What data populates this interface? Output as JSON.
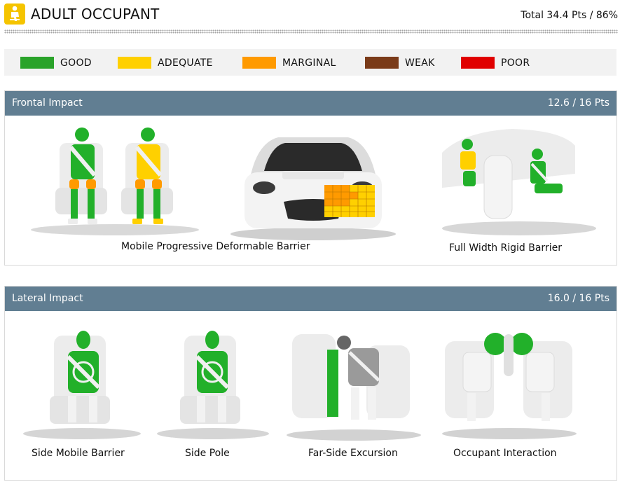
{
  "header": {
    "title": "ADULT OCCUPANT",
    "total": "Total 34.4 Pts / 86%",
    "icon": "seated-occupant-icon"
  },
  "legend": [
    {
      "label": "GOOD",
      "color": "#2aa32a"
    },
    {
      "label": "ADEQUATE",
      "color": "#ffd000"
    },
    {
      "label": "MARGINAL",
      "color": "#ff9a00"
    },
    {
      "label": "WEAK",
      "color": "#7a3b19"
    },
    {
      "label": "POOR",
      "color": "#e00000"
    }
  ],
  "frontal": {
    "title": "Frontal Impact",
    "points": "12.6 / 16 Pts",
    "tests": [
      {
        "label": "Mobile Progressive Deformable Barrier"
      },
      {
        "label": "Full Width Rigid Barrier"
      }
    ]
  },
  "lateral": {
    "title": "Lateral Impact",
    "points": "16.0 / 16 Pts",
    "tests": [
      {
        "label": "Side Mobile Barrier"
      },
      {
        "label": "Side Pole"
      },
      {
        "label": "Far-Side Excursion"
      },
      {
        "label": "Occupant Interaction"
      }
    ]
  },
  "colors": {
    "header_bar": "#617e92",
    "good": "#2aa32a",
    "adequate": "#ffd000",
    "marginal": "#ff9a00",
    "seat": "#e9e9e9"
  }
}
